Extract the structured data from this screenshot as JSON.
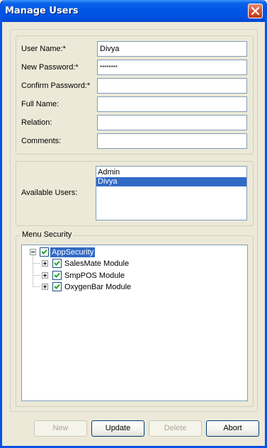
{
  "window": {
    "title": "Manage Users"
  },
  "user_form": {
    "fields": [
      {
        "label": "User Name:*",
        "value": "Divya"
      },
      {
        "label": "New Password:*",
        "value": "********"
      },
      {
        "label": "Confirm Password:*",
        "value": ""
      },
      {
        "label": "Full Name:",
        "value": ""
      },
      {
        "label": "Relation:",
        "value": ""
      },
      {
        "label": "Comments:",
        "value": ""
      }
    ]
  },
  "available_users": {
    "label": "Available Users:",
    "items": [
      "Admin",
      "Divya"
    ],
    "selected": "Divya"
  },
  "menu_security": {
    "legend": "Menu Security",
    "root": {
      "label": "AppSecurity",
      "checked": true,
      "expanded": true
    },
    "children": [
      {
        "label": "SalesMate Module",
        "checked": true,
        "expanded": false
      },
      {
        "label": "SmpPOS Module",
        "checked": true,
        "expanded": false
      },
      {
        "label": "OxygenBar Module",
        "checked": true,
        "expanded": false
      }
    ]
  },
  "buttons": {
    "new": {
      "label": "New",
      "enabled": false
    },
    "update": {
      "label": "Update",
      "enabled": true
    },
    "delete": {
      "label": "Delete",
      "enabled": false
    },
    "abort": {
      "label": "Abort",
      "enabled": true
    }
  },
  "colors": {
    "titlebar": "#0054e3",
    "selection": "#316ac5",
    "face": "#ece9d8",
    "close": "#d9512e"
  }
}
